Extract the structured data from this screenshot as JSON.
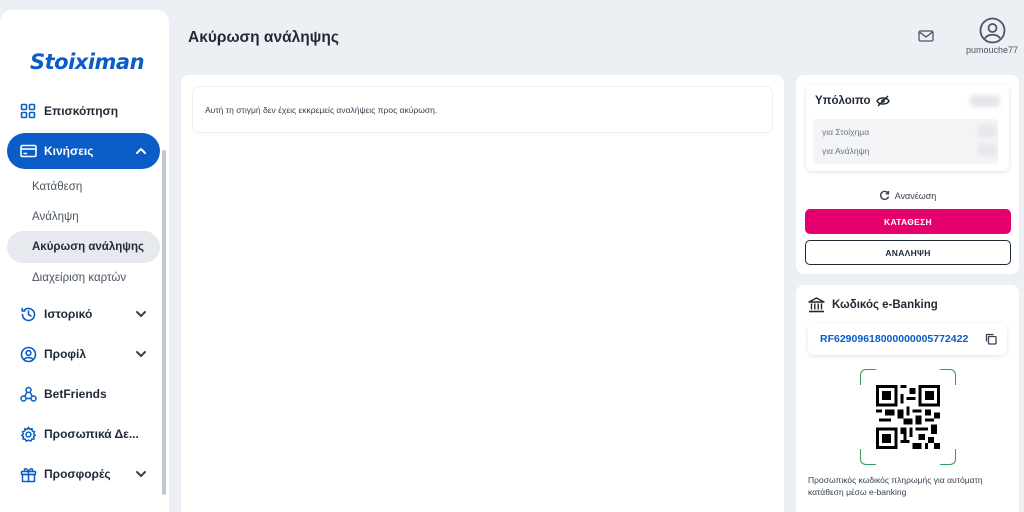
{
  "brand": {
    "logo_text": "Stoiximan",
    "primary": "#0a5cc7",
    "accent": "#e6006e"
  },
  "sidebar": {
    "items": [
      {
        "label": "Επισκόπηση",
        "icon": "grid-icon"
      },
      {
        "label": "Κινήσεις",
        "icon": "card-icon",
        "expanded": true,
        "active": true
      },
      {
        "label": "Ιστορικό",
        "icon": "history-icon"
      },
      {
        "label": "Προφίλ",
        "icon": "user-circle-icon"
      },
      {
        "label": "BetFriends",
        "icon": "friends-icon"
      },
      {
        "label": "Προσωπικά Δε...",
        "icon": "gear-icon"
      },
      {
        "label": "Προσφορές",
        "icon": "gift-icon"
      }
    ],
    "sub_items": [
      {
        "label": "Κατάθεση"
      },
      {
        "label": "Ανάληψη"
      },
      {
        "label": "Ακύρωση ανάληψης",
        "selected": true
      },
      {
        "label": "Διαχείριση καρτών"
      }
    ]
  },
  "header": {
    "title": "Ακύρωση ανάληψης",
    "username": "pumouche77"
  },
  "main": {
    "message": "Αυτή τη στιγμή δεν έχεις εκκρεμείς αναλήψεις προς ακύρωση."
  },
  "balance": {
    "title": "Υπόλοιπο",
    "total_value": "",
    "rows": [
      {
        "label": "για Στοίχημα",
        "value": ""
      },
      {
        "label": "για Ανάληψη",
        "value": ""
      }
    ],
    "refresh_label": "Ανανέωση",
    "deposit_label": "ΚΑΤΑΘΕΣΗ",
    "withdraw_label": "ΑΝΑΛΗΨΗ"
  },
  "ebanking": {
    "title": "Κωδικός e-Banking",
    "code": "RF62909618000000005772422",
    "note": "Προσωπικός κωδικός πληρωμής για αυτόματη κατάθεση μέσω e-banking"
  }
}
